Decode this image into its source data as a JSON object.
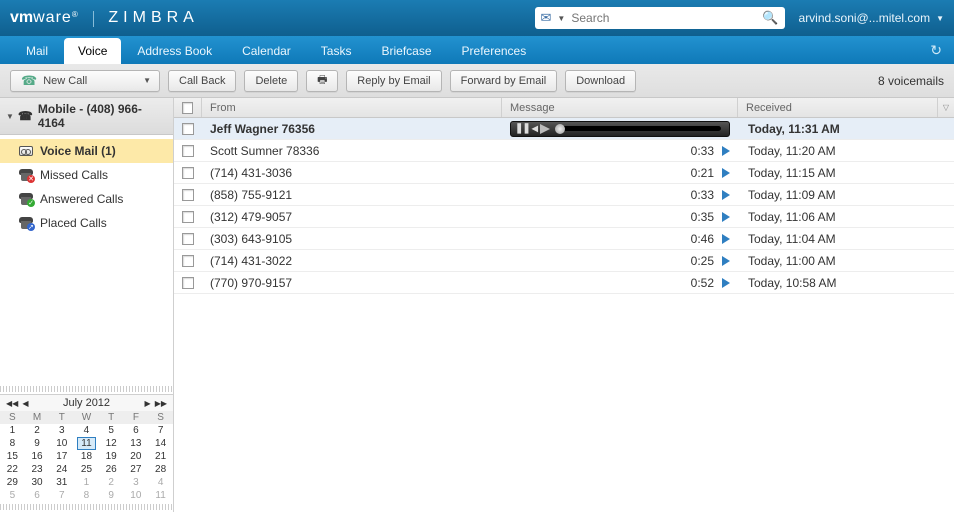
{
  "brand": {
    "vm": "vm",
    "ware": "ware",
    "sup": "®",
    "zimbra": "ZIMBRA"
  },
  "search": {
    "placeholder": "Search"
  },
  "user": {
    "label": "arvind.soni@...mitel.com"
  },
  "tabs": [
    "Mail",
    "Voice",
    "Address Book",
    "Calendar",
    "Tasks",
    "Briefcase",
    "Preferences"
  ],
  "active_tab": 1,
  "toolbar": {
    "newcall": "New Call",
    "callback": "Call Back",
    "delete": "Delete",
    "reply": "Reply by Email",
    "forward": "Forward by Email",
    "download": "Download",
    "count": "8 voicemails"
  },
  "sidebar": {
    "phone_label": "Mobile - (408) 966-4164",
    "items": [
      {
        "label": "Voice Mail (1)",
        "sel": true
      },
      {
        "label": "Missed Calls"
      },
      {
        "label": "Answered Calls"
      },
      {
        "label": "Placed Calls"
      }
    ]
  },
  "columns": {
    "from": "From",
    "message": "Message",
    "received": "Received"
  },
  "rows": [
    {
      "from": "Jeff Wagner  76356",
      "dur": "",
      "rec": "Today, 11:31 AM",
      "sel": true
    },
    {
      "from": "Scott Sumner  78336",
      "dur": "0:33",
      "rec": "Today, 11:20 AM"
    },
    {
      "from": "(714) 431-3036",
      "dur": "0:21",
      "rec": "Today, 11:15 AM"
    },
    {
      "from": "(858) 755-9121",
      "dur": "0:33",
      "rec": "Today, 11:09 AM"
    },
    {
      "from": "(312) 479-9057",
      "dur": "0:35",
      "rec": "Today, 11:06 AM"
    },
    {
      "from": "(303) 643-9105",
      "dur": "0:46",
      "rec": "Today, 11:04 AM"
    },
    {
      "from": "(714) 431-3022",
      "dur": "0:25",
      "rec": "Today, 11:00 AM"
    },
    {
      "from": "(770) 970-9157",
      "dur": "0:52",
      "rec": "Today, 10:58 AM"
    }
  ],
  "calendar": {
    "title": "July 2012",
    "dow": [
      "S",
      "M",
      "T",
      "W",
      "T",
      "F",
      "S"
    ],
    "weeks": [
      [
        {
          "d": 1
        },
        {
          "d": 2
        },
        {
          "d": 3
        },
        {
          "d": 4
        },
        {
          "d": 5
        },
        {
          "d": 6
        },
        {
          "d": 7
        }
      ],
      [
        {
          "d": 8
        },
        {
          "d": 9
        },
        {
          "d": 10
        },
        {
          "d": 11,
          "today": true
        },
        {
          "d": 12
        },
        {
          "d": 13
        },
        {
          "d": 14
        }
      ],
      [
        {
          "d": 15
        },
        {
          "d": 16
        },
        {
          "d": 17
        },
        {
          "d": 18
        },
        {
          "d": 19
        },
        {
          "d": 20
        },
        {
          "d": 21
        }
      ],
      [
        {
          "d": 22
        },
        {
          "d": 23
        },
        {
          "d": 24
        },
        {
          "d": 25
        },
        {
          "d": 26
        },
        {
          "d": 27
        },
        {
          "d": 28
        }
      ],
      [
        {
          "d": 29
        },
        {
          "d": 30
        },
        {
          "d": 31
        },
        {
          "d": 1,
          "off": true
        },
        {
          "d": 2,
          "off": true
        },
        {
          "d": 3,
          "off": true
        },
        {
          "d": 4,
          "off": true
        }
      ],
      [
        {
          "d": 5,
          "off": true
        },
        {
          "d": 6,
          "off": true
        },
        {
          "d": 7,
          "off": true
        },
        {
          "d": 8,
          "off": true
        },
        {
          "d": 9,
          "off": true
        },
        {
          "d": 10,
          "off": true
        },
        {
          "d": 11,
          "off": true
        }
      ]
    ]
  }
}
